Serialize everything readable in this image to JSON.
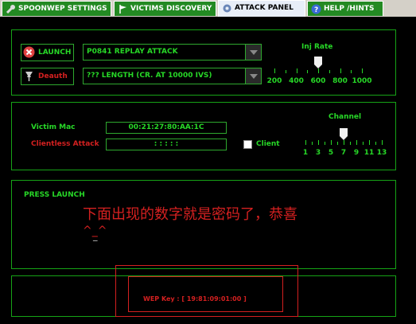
{
  "tabs": [
    {
      "label": "SPOONWEP SETTINGS",
      "icon": "wrench-icon"
    },
    {
      "label": "VICTIMS DISCOVERY",
      "icon": "tab-flag-icon"
    },
    {
      "label": "ATTACK PANEL",
      "icon": "gear-icon",
      "active": true
    },
    {
      "label": "HELP /HINTS",
      "icon": "help-icon"
    }
  ],
  "attack": {
    "launch_label": "LAUNCH",
    "deauth_label": "Deauth",
    "attack_mode": "P0841 REPLAY ATTACK",
    "iv_length": "??? LENGTH (CR. AT 10000 IVS)"
  },
  "inj_rate": {
    "title": "Inj Rate",
    "labels": [
      "200",
      "400",
      "600",
      "800",
      "1000"
    ],
    "value": 600
  },
  "victim": {
    "mac_label": "Victim Mac",
    "mac_value": "00:21:27:80:AA:1C",
    "clientless_label": "Clientless Attack",
    "clientless_value": ": : : : :",
    "client_label": "Client"
  },
  "channel": {
    "title": "Channel",
    "labels": [
      "1",
      "3",
      "5",
      "7",
      "9",
      "11",
      "13"
    ],
    "value": 7
  },
  "status": {
    "press_launch": "PRESS LAUNCH",
    "chinese_line1": "下面出现的数字就是密码了，恭喜",
    "chinese_line2": "^_^",
    "cursor": "_"
  },
  "wep": {
    "label": "WEP Key : [ 19:81:09:01:00 ]"
  },
  "colors": {
    "green": "#27d827",
    "red": "#d42020",
    "tab_green": "#238a23"
  }
}
